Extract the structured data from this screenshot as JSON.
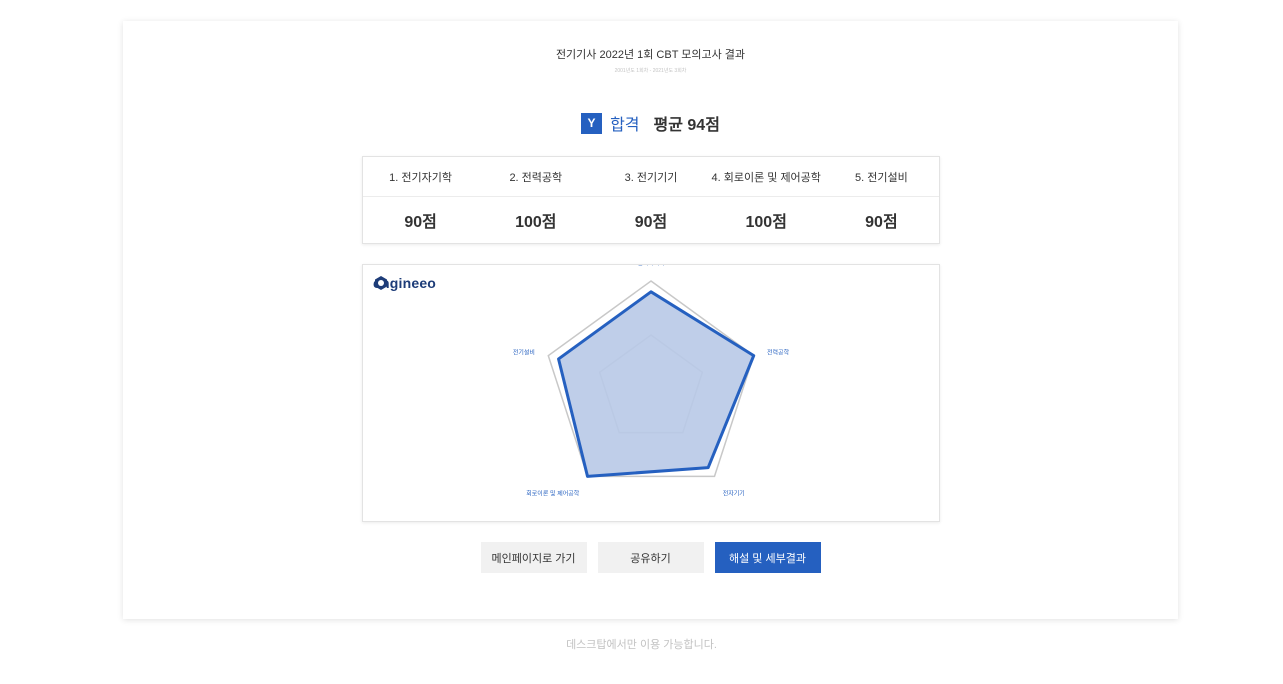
{
  "header": {
    "title": "전기기사 2022년 1회 CBT 모의고사 결과",
    "subtitle": "2001년도 1회차 - 2021년도 3회차"
  },
  "result": {
    "badge": "Y",
    "status": "합격",
    "average": "평균 94점",
    "accent_color": "#2560c0"
  },
  "scores": {
    "subjects": [
      "1. 전기자기학",
      "2. 전력공학",
      "3. 전기기기",
      "4. 회로이론 및 제어공학",
      "5. 전기설비"
    ],
    "values": [
      "90점",
      "100점",
      "90점",
      "100점",
      "90점"
    ]
  },
  "logo": {
    "text": "engineeo",
    "icon": "engineeo-logo-icon"
  },
  "chart_data": {
    "type": "radar",
    "categories": [
      "전기자기학",
      "전력공학",
      "전자기기",
      "회로이론 및 제어공학",
      "전기설비"
    ],
    "values": [
      90,
      100,
      90,
      100,
      90
    ],
    "range": [
      0,
      100
    ],
    "guide_levels": [
      50,
      100
    ],
    "series_color": "#2560c0",
    "fill_color": "#b8c9e7"
  },
  "buttons": {
    "main": "메인페이지로 가기",
    "share": "공유하기",
    "detail": "해설 및 세부결과"
  },
  "footer": {
    "notice": "데스크탑에서만 이용 가능합니다."
  }
}
